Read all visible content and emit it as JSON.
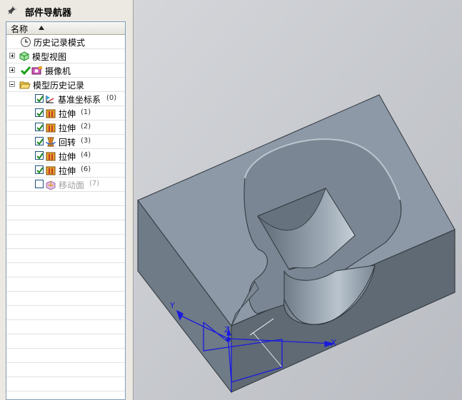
{
  "navigator": {
    "title": "部件导航器",
    "column_header": "名称",
    "items": [
      {
        "label": "历史记录模式",
        "count": ""
      },
      {
        "label": "模型视图",
        "count": ""
      },
      {
        "label": "摄像机",
        "count": ""
      },
      {
        "label": "模型历史记录",
        "count": ""
      },
      {
        "label": "基准坐标系",
        "count": "(0)",
        "checked": true
      },
      {
        "label": "拉伸",
        "count": "(1)",
        "checked": true
      },
      {
        "label": "拉伸",
        "count": "(2)",
        "checked": true
      },
      {
        "label": "回转",
        "count": "(3)",
        "checked": true
      },
      {
        "label": "拉伸",
        "count": "(4)",
        "checked": true
      },
      {
        "label": "拉伸",
        "count": "(6)",
        "checked": true
      },
      {
        "label": "移动面",
        "count": "(7)",
        "checked": false
      }
    ]
  },
  "viewport": {
    "axis_x_label": "X",
    "axis_y_label": "Y",
    "axis_z_label": "Z",
    "colors": {
      "model_top": "#8b98a6",
      "model_front": "#5f6b76",
      "model_side": "#707c88",
      "axes": "#1a1ae0"
    }
  }
}
